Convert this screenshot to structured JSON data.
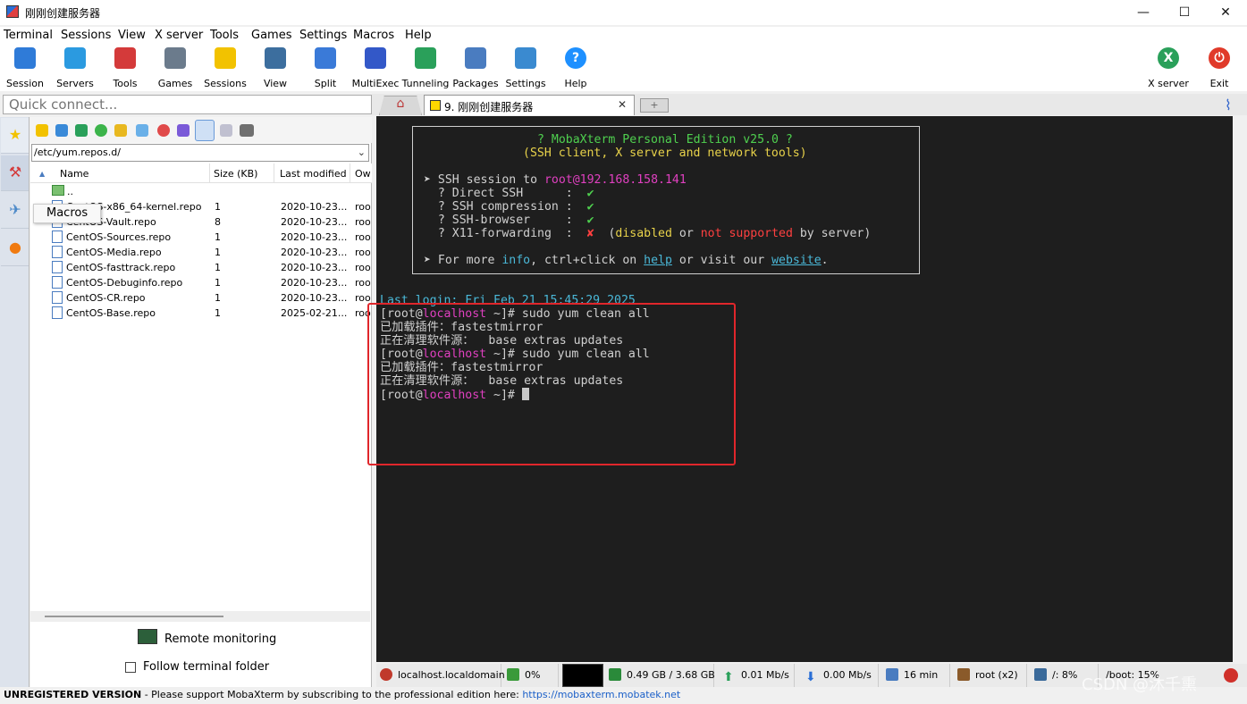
{
  "window": {
    "title": "刚刚创建服务器",
    "minimize": "—",
    "maximize": "☐",
    "close": "✕"
  },
  "menu": [
    "Terminal",
    "Sessions",
    "View",
    "X server",
    "Tools",
    "Games",
    "Settings",
    "Macros",
    "Help"
  ],
  "toolbar": {
    "left": [
      {
        "label": "Session",
        "icon": "session-icon",
        "color": "#2f7bd8"
      },
      {
        "label": "Servers",
        "icon": "servers-icon",
        "color": "#2b9ae0"
      },
      {
        "label": "Tools",
        "icon": "tools-icon",
        "color": "#d43a3a"
      },
      {
        "label": "Games",
        "icon": "games-icon",
        "color": "#6b7b8c"
      },
      {
        "label": "Sessions",
        "icon": "star-icon",
        "color": "#f2c200"
      },
      {
        "label": "View",
        "icon": "view-icon",
        "color": "#3c6e9e"
      },
      {
        "label": "Split",
        "icon": "split-icon",
        "color": "#3a7ad8"
      },
      {
        "label": "MultiExec",
        "icon": "multiexec-icon",
        "color": "#3358c8"
      },
      {
        "label": "Tunneling",
        "icon": "tunneling-icon",
        "color": "#2aa05a"
      },
      {
        "label": "Packages",
        "icon": "packages-icon",
        "color": "#4a7cc0"
      },
      {
        "label": "Settings",
        "icon": "settings-icon",
        "color": "#3a8ad0"
      },
      {
        "label": "Help",
        "icon": "help-icon",
        "color": "#1e90ff",
        "glyph": "?"
      }
    ],
    "right": [
      {
        "label": "X server",
        "icon": "xserver-icon",
        "color": "#2aa05a",
        "glyph": "X"
      },
      {
        "label": "Exit",
        "icon": "exit-icon",
        "color": "#e03a2a",
        "glyph": "⏻"
      }
    ]
  },
  "quick_connect": {
    "placeholder": "Quick connect..."
  },
  "sidebar_tooltip": "Macros",
  "file_browser": {
    "path": "/etc/yum.repos.d/",
    "columns": [
      "Name",
      "Size (KB)",
      "Last modified",
      "Ow"
    ],
    "parent": "..",
    "files": [
      {
        "name": "CentOS-x86_64-kernel.repo",
        "size": "1",
        "modified": "2020-10-23...",
        "owner": "roo"
      },
      {
        "name": "CentOS-Vault.repo",
        "size": "8",
        "modified": "2020-10-23...",
        "owner": "roo"
      },
      {
        "name": "CentOS-Sources.repo",
        "size": "1",
        "modified": "2020-10-23...",
        "owner": "roo"
      },
      {
        "name": "CentOS-Media.repo",
        "size": "1",
        "modified": "2020-10-23...",
        "owner": "roo"
      },
      {
        "name": "CentOS-fasttrack.repo",
        "size": "1",
        "modified": "2020-10-23...",
        "owner": "roo"
      },
      {
        "name": "CentOS-Debuginfo.repo",
        "size": "1",
        "modified": "2020-10-23...",
        "owner": "roo"
      },
      {
        "name": "CentOS-CR.repo",
        "size": "1",
        "modified": "2020-10-23...",
        "owner": "roo"
      },
      {
        "name": "CentOS-Base.repo",
        "size": "1",
        "modified": "2025-02-21...",
        "owner": "roo"
      }
    ],
    "remote_monitoring": "Remote monitoring",
    "follow_terminal": "Follow terminal folder"
  },
  "tabs": {
    "session_label": "9. 刚刚创建服务器",
    "close": "✕",
    "new_tab": "+"
  },
  "terminal": {
    "banner": {
      "line1": "? MobaXterm Personal Edition v25.0 ?",
      "line2": "(SSH client, X server and network tools)",
      "ssh_prefix": "➤ SSH session to ",
      "ssh_target": "root@192.168.158.141",
      "direct_ssh": "  ? Direct SSH      :  ",
      "compression": "  ? SSH compression :  ",
      "browser": "  ? SSH-browser     :  ",
      "x11": "  ? X11-forwarding  :  ",
      "check": "✔",
      "cross": "✘",
      "x11_a": "  (",
      "x11_disabled": "disabled",
      "x11_or": " or ",
      "x11_notsupported": "not supported",
      "x11_tail": " by server)",
      "more_a": "➤ For more ",
      "more_info": "info",
      "more_b": ", ctrl+click on ",
      "more_help": "help",
      "more_c": " or visit our ",
      "more_site": "website",
      "more_d": "."
    },
    "last_login": "Last login: Fri Feb 21 15:45:29 2025",
    "prompt_open": "[root@",
    "prompt_host": "localhost",
    "prompt_close": " ~]# ",
    "command1": "sudo yum clean all",
    "output1": "已加载插件：fastestmirror",
    "output2": "正在清理软件源：  base extras updates",
    "command2": "sudo yum clean all",
    "output3": "已加载插件：fastestmirror",
    "output4": "正在清理软件源：  base extras updates"
  },
  "status": {
    "host": "localhost.localdomain",
    "cpu": "0%",
    "memory": "0.49 GB / 3.68 GB",
    "upload": "0.01 Mb/s",
    "download": "0.00 Mb/s",
    "uptime": "16 min",
    "user": "root (x2)",
    "disk_root": "/: 8%",
    "disk_boot": "/boot: 15%"
  },
  "footer": {
    "unregistered": "UNREGISTERED VERSION",
    "message": "  -  Please support MobaXterm by subscribing to the professional edition here: ",
    "link": "https://mobaxterm.mobatek.net"
  },
  "watermark": "CSDN @沐千熏"
}
